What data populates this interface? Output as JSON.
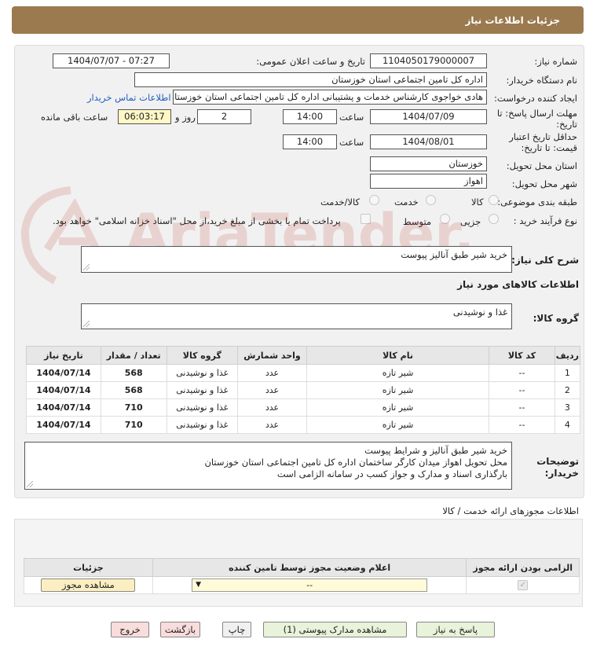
{
  "header": {
    "title": "جزئیات اطلاعات نیاز"
  },
  "form": {
    "need_number_label": "شماره نیاز:",
    "need_number": "1104050179000007",
    "announce_label": "تاریخ و ساعت اعلان عمومی:",
    "announce_value": "1404/07/07 - 07:27",
    "buyer_org_label": "نام دستگاه خریدار:",
    "buyer_org": "اداره کل تامین اجتماعی استان خوزستان",
    "creator_label": "ایجاد کننده درخواست:",
    "creator": "هادی خواجوی کارشناس خدمات و پشتیبانی اداره کل تامین اجتماعی استان خوزستان",
    "contact_link": "اطلاعات تماس خریدار",
    "deadline_label_1": "مهلت ارسال پاسخ: تا",
    "deadline_label_2": "تاریخ:",
    "deadline_date": "1404/07/09",
    "time_label": "ساعت",
    "deadline_time": "14:00",
    "days_value": "2",
    "days_label": "روز و",
    "remaining_value": "06:03:17",
    "remaining_label": "ساعت باقی مانده",
    "validity_label_1": "حداقل تاریخ اعتبار",
    "validity_label_2": "قیمت: تا تاریخ:",
    "validity_date": "1404/08/01",
    "validity_time": "14:00",
    "province_label": "استان محل تحویل:",
    "province": "خوزستان",
    "city_label": "شهر محل تحویل:",
    "city": "اهواز",
    "category_label": "طبقه بندی موضوعی:",
    "category_options": [
      "کالا",
      "خدمت",
      "کالا/خدمت"
    ],
    "process_label": "نوع فرآیند خرید :",
    "process_options": [
      "جزیی",
      "متوسط"
    ],
    "payment_note": "پرداخت تمام یا بخشی از مبلغ خرید،از محل \"اسناد خزانه اسلامی\" خواهد بود."
  },
  "summary": {
    "label": "شرح کلی نیاز:",
    "value": "خرید شیر طبق آنالیز پیوست"
  },
  "goods": {
    "section_title": "اطلاعات کالاهای مورد نیاز",
    "group_label": "گروه کالا:",
    "group_value": "غذا و نوشیدنی",
    "columns": [
      "ردیف",
      "کد کالا",
      "نام کالا",
      "واحد شمارش",
      "گروه کالا",
      "تعداد / مقدار",
      "تاریخ نیاز"
    ],
    "rows": [
      [
        "1",
        "--",
        "شیر تازه",
        "عدد",
        "غذا و نوشیدنی",
        "568",
        "1404/07/14"
      ],
      [
        "2",
        "--",
        "شیر تازه",
        "عدد",
        "غذا و نوشیدنی",
        "568",
        "1404/07/14"
      ],
      [
        "3",
        "--",
        "شیر تازه",
        "عدد",
        "غذا و نوشیدنی",
        "710",
        "1404/07/14"
      ],
      [
        "4",
        "--",
        "شیر تازه",
        "عدد",
        "غذا و نوشیدنی",
        "710",
        "1404/07/14"
      ]
    ]
  },
  "buyer_notes": {
    "label_1": "توضیحات",
    "label_2": "خریدار:",
    "lines": [
      "خرید شیر طبق آنالیز و شرایط پیوست",
      "محل تحویل اهواز میدان کارگر ساختمان اداره کل تامین اجتماعی استان خوزستان",
      "بارگذاری اسناد و مدارک و جواز کسب در سامانه الزامی است"
    ]
  },
  "permits": {
    "section_title": "اطلاعات مجوزهای ارائه خدمت / کالا",
    "columns": [
      "الزامی بودن ارائه مجوز",
      "اعلام وضعیت مجوز توسط تامین کننده",
      "جزئیات"
    ],
    "status_value": "--",
    "view_button": "مشاهده مجوز"
  },
  "actions": {
    "reply": "پاسخ به نیاز",
    "view_docs": "مشاهده مدارک پیوستی (1)",
    "print": "چاپ",
    "back": "بازگشت",
    "exit": "خروج"
  },
  "watermark": {
    "text": "AriaTender.neT"
  },
  "colors": {
    "title_bar": "#9b7a4f",
    "link": "#2060c0",
    "button_green": "#e8f3d9",
    "button_pink": "#f9dcdc"
  }
}
